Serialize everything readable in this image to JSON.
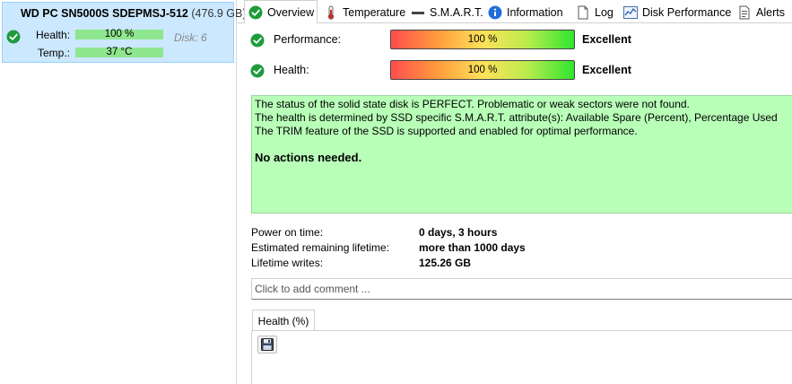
{
  "disk": {
    "name": "WD PC SN5000S SDEPMSJ-512",
    "size": "(476.9 GB)",
    "health_label": "Health:",
    "health_value": "100 %",
    "temp_label": "Temp.:",
    "temp_value": "37 °C",
    "disk_number": "Disk: 6"
  },
  "tabs": [
    {
      "label": "Overview",
      "icon": "check-circle-icon"
    },
    {
      "label": "Temperature",
      "icon": "thermometer-icon"
    },
    {
      "label": "S.M.A.R.T.",
      "icon": "dash-icon"
    },
    {
      "label": "Information",
      "icon": "info-icon"
    },
    {
      "label": "Log",
      "icon": "document-icon"
    },
    {
      "label": "Disk Performance",
      "icon": "performance-chart-icon"
    },
    {
      "label": "Alerts",
      "icon": "alerts-document-icon"
    }
  ],
  "overview": {
    "performance_label": "Performance:",
    "performance_value": "100 %",
    "performance_rating": "Excellent",
    "health_label": "Health:",
    "health_value": "100 %",
    "health_rating": "Excellent",
    "status_lines": [
      "The status of the solid state disk is PERFECT. Problematic or weak sectors were not found.",
      "The health is determined by SSD specific S.M.A.R.T. attribute(s):  Available Spare (Percent), Percentage Used",
      "The TRIM feature of the SSD is supported and enabled for optimal performance."
    ],
    "action": "No actions needed.",
    "power_on_label": "Power on time:",
    "power_on_value": "0 days, 3 hours",
    "lifetime_label": "Estimated remaining lifetime:",
    "lifetime_value": "more than 1000 days",
    "writes_label": "Lifetime writes:",
    "writes_value": "125.26 GB",
    "comment_placeholder": "Click to add comment ...",
    "graph_tab": "Health (%)"
  },
  "colors": {
    "selected_card": "#cce8ff",
    "status_background": "#b8ffb8",
    "mini_bar": "#8ee68e",
    "check_green": "#1e9b3c"
  }
}
